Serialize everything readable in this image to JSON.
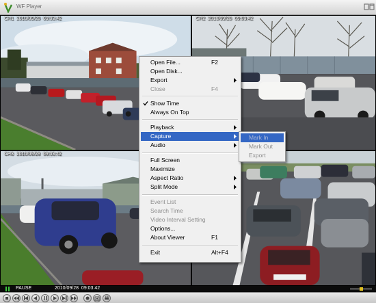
{
  "window": {
    "title": "WF Player",
    "icon": "dvr-player-icon"
  },
  "cameras": [
    {
      "label": "CH1  2010/09/28  09:03:42"
    },
    {
      "label": "CH2  2010/09/28  09:03:42"
    },
    {
      "label": "CH3  2010/09/28  09:03:42"
    },
    {
      "label": ""
    }
  ],
  "status": {
    "state": "PAUSE",
    "timestamp": "2010/09/28  09:03:42"
  },
  "context_menu": {
    "items": [
      {
        "label": "Open File...",
        "shortcut": "F2"
      },
      {
        "label": "Open Disk...",
        "shortcut": ""
      },
      {
        "label": "Export",
        "shortcut": ""
      },
      {
        "label": "Close",
        "shortcut": "F4"
      },
      {
        "label": "Show Time",
        "shortcut": ""
      },
      {
        "label": "Always On Top",
        "shortcut": ""
      },
      {
        "label": "Playback",
        "shortcut": ""
      },
      {
        "label": "Capture",
        "shortcut": ""
      },
      {
        "label": "Audio",
        "shortcut": ""
      },
      {
        "label": "Full Screen",
        "shortcut": ""
      },
      {
        "label": "Maximize",
        "shortcut": ""
      },
      {
        "label": "Aspect Ratio",
        "shortcut": ""
      },
      {
        "label": "Split Mode",
        "shortcut": ""
      },
      {
        "label": "Event List",
        "shortcut": ""
      },
      {
        "label": "Search Time",
        "shortcut": ""
      },
      {
        "label": "Video Interval Setting",
        "shortcut": ""
      },
      {
        "label": "Options...",
        "shortcut": ""
      },
      {
        "label": "About Viewer",
        "shortcut": "F1"
      },
      {
        "label": "Exit",
        "shortcut": "Alt+F4"
      }
    ],
    "highlighted": "Capture",
    "checked": "Show Time"
  },
  "capture_submenu": {
    "items": [
      {
        "label": "Mark In"
      },
      {
        "label": "Mark Out"
      },
      {
        "label": "Export"
      }
    ]
  },
  "controls": [
    "stop-icon",
    "rewind-icon",
    "step-back-icon",
    "play-back-icon",
    "pause-icon",
    "play-icon",
    "step-forward-icon",
    "fast-forward-icon",
    "record-icon",
    "snapshot-icon",
    "print-icon"
  ],
  "colors": {
    "menu_highlight": "#3467c4",
    "menu_bg": "#f0f0f0",
    "disabled_text": "#8d8d8d"
  }
}
